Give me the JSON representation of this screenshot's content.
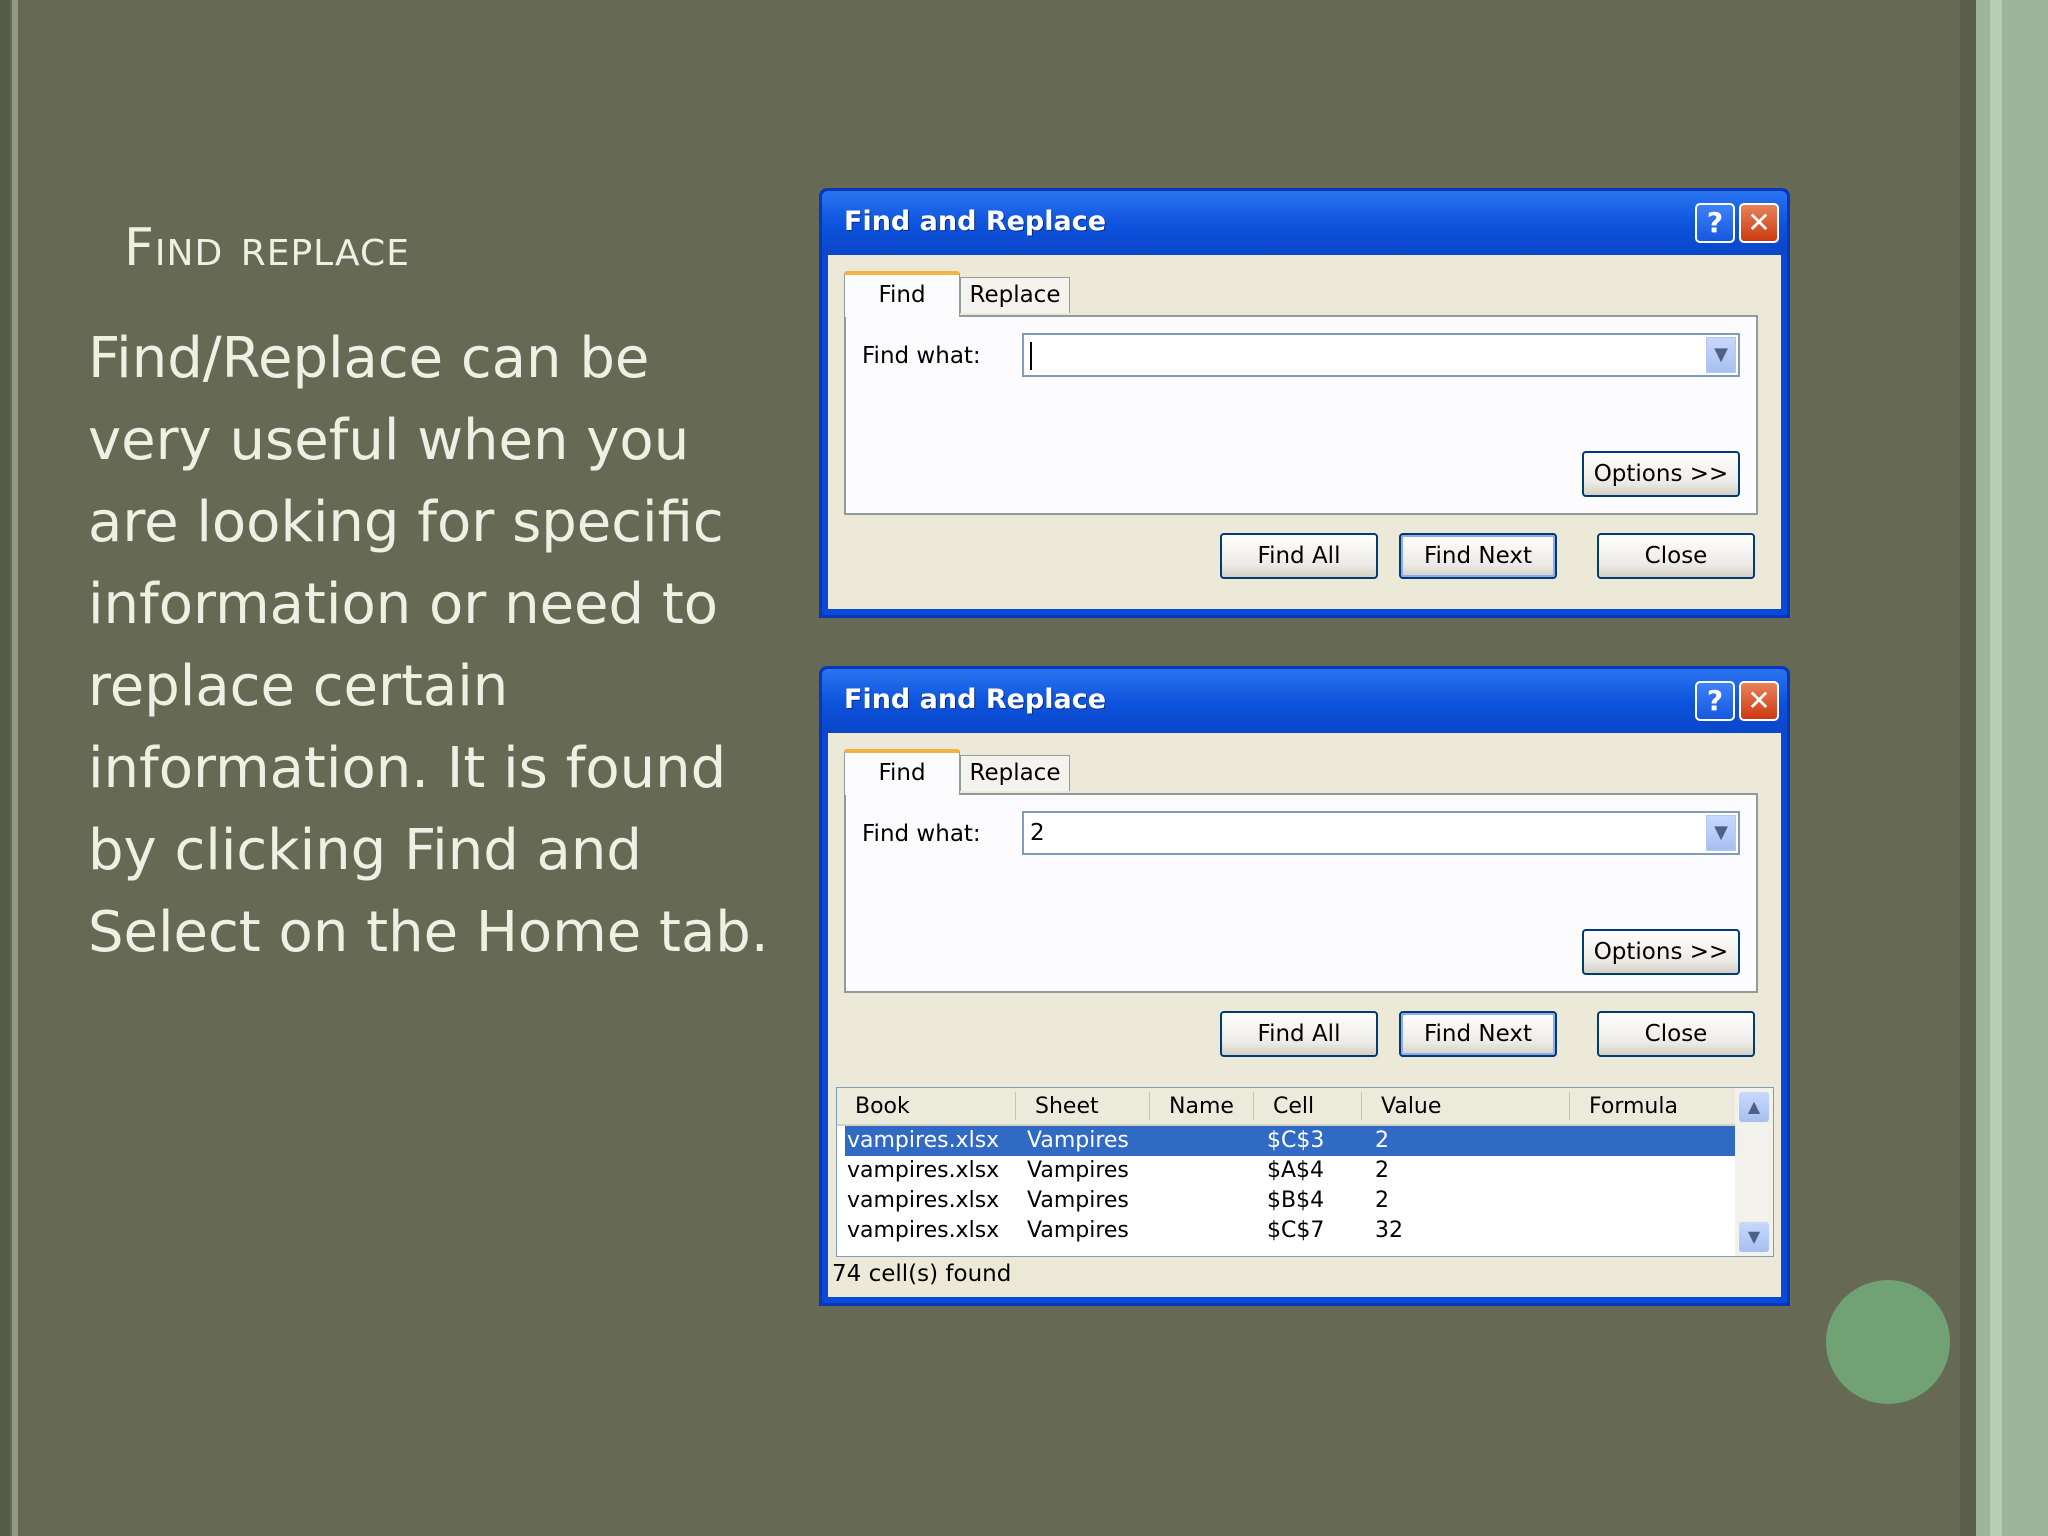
{
  "slide": {
    "title": "Find replace",
    "body": "Find/Replace can be very useful when you are looking for specific information or need to replace certain information. It is found by clicking Find and Select on the Home tab."
  },
  "dialog1": {
    "title": "Find and Replace",
    "tabs": {
      "find": "Find",
      "replace": "Replace"
    },
    "find_label": "Find what:",
    "find_value": "",
    "options_label": "Options >>",
    "find_all_label": "Find All",
    "find_next_label": "Find Next",
    "close_label": "Close"
  },
  "dialog2": {
    "title": "Find and Replace",
    "tabs": {
      "find": "Find",
      "replace": "Replace"
    },
    "find_label": "Find what:",
    "find_value": "2",
    "options_label": "Options >>",
    "find_all_label": "Find All",
    "find_next_label": "Find Next",
    "close_label": "Close",
    "results": {
      "columns": [
        "Book",
        "Sheet",
        "Name",
        "Cell",
        "Value",
        "Formula"
      ],
      "rows": [
        {
          "book": "vampires.xlsx",
          "sheet": "Vampires",
          "name": "",
          "cell": "$C$3",
          "value": "2",
          "formula": ""
        },
        {
          "book": "vampires.xlsx",
          "sheet": "Vampires",
          "name": "",
          "cell": "$A$4",
          "value": "2",
          "formula": ""
        },
        {
          "book": "vampires.xlsx",
          "sheet": "Vampires",
          "name": "",
          "cell": "$B$4",
          "value": "2",
          "formula": ""
        },
        {
          "book": "vampires.xlsx",
          "sheet": "Vampires",
          "name": "",
          "cell": "$C$7",
          "value": "32",
          "formula": ""
        }
      ]
    },
    "status": "74 cell(s) found"
  },
  "icons": {
    "help": "help-icon",
    "close": "close-icon",
    "dropdown": "chevron-down-icon",
    "scroll_up": "scroll-up-icon",
    "scroll_down": "scroll-down-icon"
  }
}
